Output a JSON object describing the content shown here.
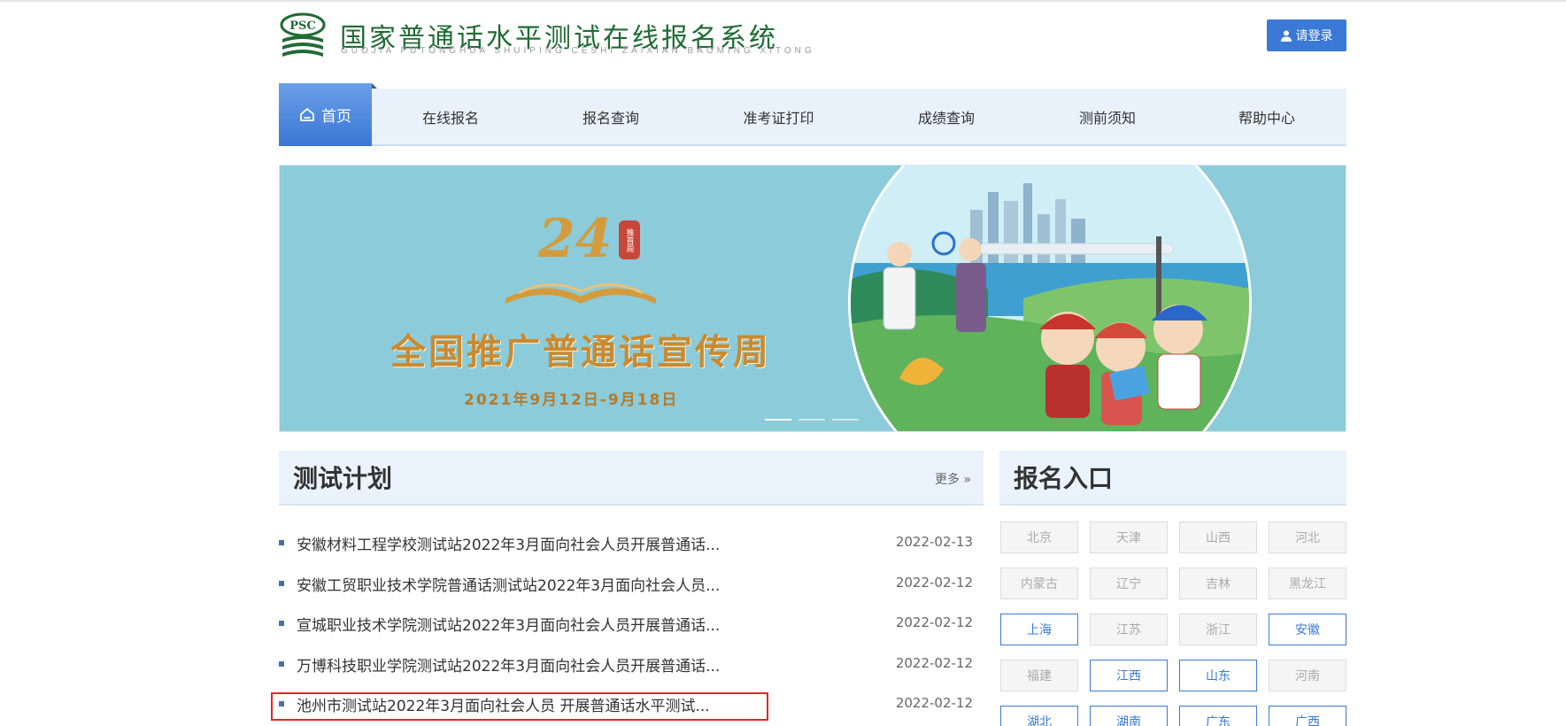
{
  "header": {
    "title": "国家普通话水平测试在线报名系统",
    "subtitle": "GUOJIA PUTONGHUA SHUIPING CESHI ZAIXIAN BAOMING XITONG",
    "logo_text": "PSC",
    "login_label": "请登录",
    "brand_color": "#1f6b34",
    "accent_color": "#3a7ad6"
  },
  "nav": {
    "home": "首页",
    "items": [
      "在线报名",
      "报名查询",
      "准考证打印",
      "成绩查询",
      "测前须知",
      "帮助中心"
    ]
  },
  "banner": {
    "number": "24",
    "badge": "推普周",
    "headline": "全国推广普通话宣传周",
    "date": "2021年9月12日-9月18日"
  },
  "plan": {
    "title": "测试计划",
    "more": "更多 »",
    "items": [
      {
        "text": "安徽材料工程学校测试站2022年3月面向社会人员开展普通话...",
        "date": "2022-02-13"
      },
      {
        "text": "安徽工贸职业技术学院普通话测试站2022年3月面向社会人员...",
        "date": "2022-02-12"
      },
      {
        "text": "宣城职业技术学院测试站2022年3月面向社会人员开展普通话...",
        "date": "2022-02-12"
      },
      {
        "text": "万博科技职业学院测试站2022年3月面向社会人员开展普通话...",
        "date": "2022-02-12"
      },
      {
        "text": "池州市测试站2022年3月面向社会人员 开展普通话水平测试...",
        "date": "2022-02-12"
      }
    ]
  },
  "entry": {
    "title": "报名入口",
    "provinces": [
      {
        "name": "北京",
        "active": false
      },
      {
        "name": "天津",
        "active": false
      },
      {
        "name": "山西",
        "active": false
      },
      {
        "name": "河北",
        "active": false
      },
      {
        "name": "内蒙古",
        "active": false
      },
      {
        "name": "辽宁",
        "active": false
      },
      {
        "name": "吉林",
        "active": false
      },
      {
        "name": "黑龙江",
        "active": false
      },
      {
        "name": "上海",
        "active": true
      },
      {
        "name": "江苏",
        "active": false
      },
      {
        "name": "浙江",
        "active": false
      },
      {
        "name": "安徽",
        "active": true
      },
      {
        "name": "福建",
        "active": false
      },
      {
        "name": "江西",
        "active": true
      },
      {
        "name": "山东",
        "active": true
      },
      {
        "name": "河南",
        "active": false
      },
      {
        "name": "湖北",
        "active": true
      },
      {
        "name": "湖南",
        "active": true
      },
      {
        "name": "广东",
        "active": true
      },
      {
        "name": "广西",
        "active": true
      }
    ]
  }
}
